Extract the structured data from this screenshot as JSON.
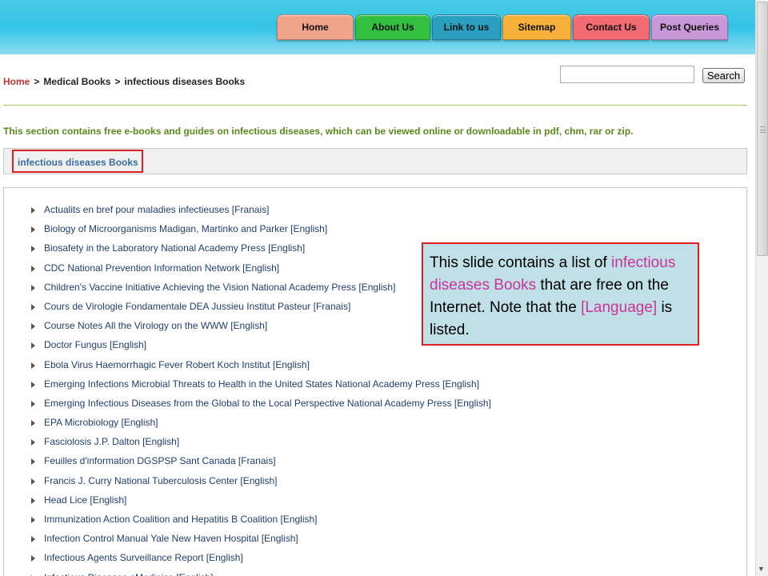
{
  "nav": {
    "items": [
      {
        "label": "Home",
        "color": "#f0a48a",
        "width": 96
      },
      {
        "label": "About Us",
        "color": "#33c040",
        "width": 94
      },
      {
        "label": "Link to us",
        "color": "#2a9fbf",
        "width": 86
      },
      {
        "label": "Sitemap",
        "color": "#f5b13a",
        "width": 86
      },
      {
        "label": "Contact Us",
        "color": "#f26a72",
        "width": 96
      },
      {
        "label": "Post Queries",
        "color": "#c998d8",
        "width": 96
      }
    ]
  },
  "breadcrumb": {
    "home": "Home",
    "separator": ">",
    "level1": "Medical Books",
    "level2": "infectious diseases Books"
  },
  "search": {
    "value": "",
    "button_label": "Search"
  },
  "intro_text": "This section contains free e-books and guides on infectious diseases, which can be viewed online or downloadable in pdf, chm, rar or zip.",
  "section_title": "infectious diseases Books",
  "books": [
    "Actualits en bref pour maladies infectieuses [Franais]",
    "Biology of Microorganisms Madigan, Martinko and Parker [English]",
    "Biosafety in the Laboratory National Academy Press [English]",
    "CDC National Prevention Information Network [English]",
    "Children's Vaccine Initiative Achieving the Vision National Academy Press [English]",
    "Cours de Virologie Fondamentale DEA Jussieu Institut Pasteur [Franais]",
    "Course Notes All the Virology on the WWW [English]",
    "Doctor Fungus [English]",
    "Ebola Virus Haemorrhagic Fever Robert Koch Institut [English]",
    "Emerging Infections Microbial Threats to Health in the United States National Academy Press [English]",
    "Emerging Infectious Diseases from the Global to the Local Perspective National Academy Press [English]",
    "EPA Microbiology [English]",
    "Fasciolosis J.P. Dalton [English]",
    "Feuilles d'information DGSPSP Sant Canada [Franais]",
    "Francis J. Curry National Tuberculosis Center [English]",
    "Head Lice [English]",
    "Immunization Action Coalition and Hepatitis B Coalition [English]",
    "Infection Control Manual Yale New Haven Hospital [English]",
    "Infectious Agents Surveillance Report [English]",
    "Infectious Diseases eMedicine [English]"
  ],
  "callout": {
    "part1": "This slide contains a list of ",
    "highlight1": "infectious diseases Books",
    "part2": " that are free on the Internet.  Note that the ",
    "highlight2": "[Language]",
    "part3": " is listed."
  }
}
